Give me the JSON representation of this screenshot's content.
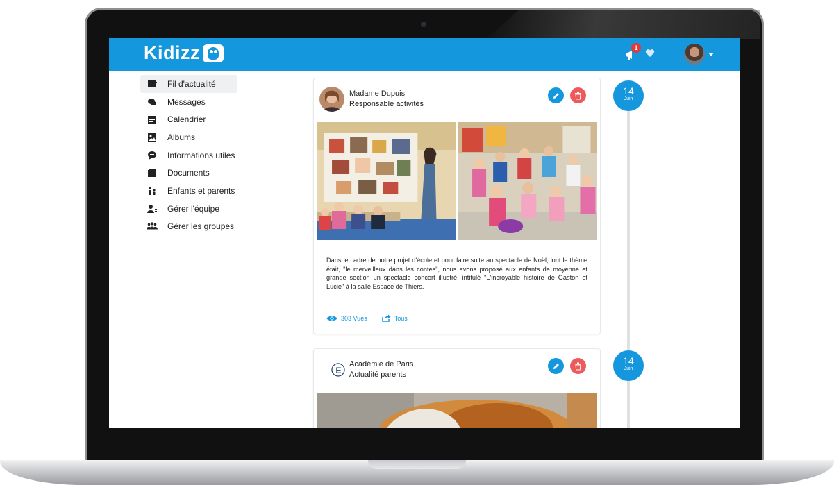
{
  "app": {
    "logo_text": "Kidizz"
  },
  "header": {
    "notification_count": "1"
  },
  "sidebar": {
    "items": [
      {
        "label": "Fil d'actualité",
        "icon": "newspaper-icon",
        "active": true
      },
      {
        "label": "Messages",
        "icon": "chat-icon"
      },
      {
        "label": "Calendrier",
        "icon": "calendar-icon"
      },
      {
        "label": "Albums",
        "icon": "image-icon"
      },
      {
        "label": "Informations utiles",
        "icon": "info-bubble-icon"
      },
      {
        "label": "Documents",
        "icon": "document-icon"
      },
      {
        "label": "Enfants et parents",
        "icon": "family-icon"
      },
      {
        "label": "Gérer l'équipe",
        "icon": "team-icon"
      },
      {
        "label": "Gérer les groupes",
        "icon": "groups-icon"
      }
    ]
  },
  "posts": [
    {
      "author_name": "Madame Dupuis",
      "author_role": "Responsable activités",
      "date_day": "14",
      "date_month": "Juin",
      "body": "Dans le cadre de notre projet d'école et pour faire suite au spectacle de Noël,dont le thème était, \"le merveilleux dans les contes\", nous avons proposé aux enfants de moyenne et grande section un spectacle concert illustré, intitulé \"L'incroyable histoire de Gaston et Lucie\" à la salle Espace de Thiers.",
      "views_label": "303 Vues",
      "share_label": "Tous"
    },
    {
      "author_name": "Académie de Paris",
      "author_role": "Actualité parents",
      "date_day": "14",
      "date_month": "Juin"
    }
  ],
  "colors": {
    "brand": "#1497dd",
    "danger": "#ee5a5a"
  }
}
